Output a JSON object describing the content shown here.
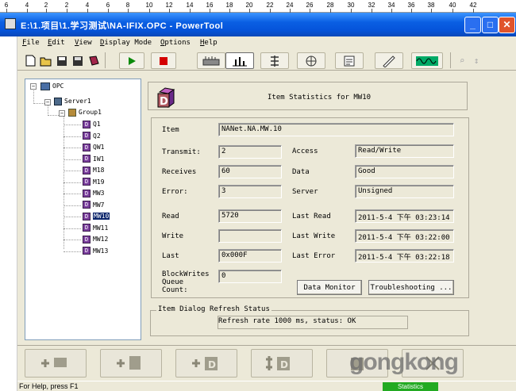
{
  "ruler": {
    "ticks": [
      "6",
      "4",
      "2",
      "2",
      "4",
      "6",
      "8",
      "10",
      "12",
      "14",
      "16",
      "18",
      "20",
      "22",
      "24",
      "26",
      "28",
      "30",
      "32",
      "34",
      "36",
      "38",
      "40",
      "42"
    ]
  },
  "window": {
    "title": "E:\\1.项目\\1.学习测试\\NA-IFIX.OPC - PowerTool",
    "min": "_",
    "max": "□",
    "close": "✕"
  },
  "menu": [
    "File",
    "Edit",
    "View",
    "Display Mode",
    "Options",
    "Help"
  ],
  "tree": {
    "root": "OPC",
    "server": "Server1",
    "group": "Group1",
    "items": [
      "Q1",
      "Q2",
      "QW1",
      "IW1",
      "M18",
      "M19",
      "MW3",
      "MW7",
      "MW10",
      "MW11",
      "MW12",
      "MW13"
    ],
    "selected": "MW10"
  },
  "header": {
    "title": "Item Statistics for MW10"
  },
  "form": {
    "item_label": "Item",
    "item_value": "NANet.NA.MW.10",
    "transmit_label": "Transmit:",
    "transmit_value": "2",
    "access_label": "Access",
    "access_value": "Read/Write",
    "receives_label": "Receives",
    "receives_value": "60",
    "data_label": "Data",
    "data_value": "Good",
    "error_label": "Error:",
    "error_value": "3",
    "server_label": "Server",
    "server_value": "Unsigned",
    "read_label": "Read",
    "read_value": "5720",
    "last_read_label": "Last Read",
    "last_read_value": "2011-5-4 下午 03:23:14",
    "write_label": "Write",
    "write_value": "",
    "last_write_label": "Last Write",
    "last_write_value": "2011-5-4 下午 03:22:00",
    "last_label": "Last",
    "last_value": "0x000F",
    "last_error_label": "Last Error",
    "last_error_value": "2011-5-4 下午 03:22:18",
    "blockwrites_label_1": "BlockWrites",
    "blockwrites_label_2": "Queue",
    "blockwrites_label_3": "Count:",
    "blockwrites_value": "0",
    "data_monitor_button": "Data Monitor",
    "troubleshooting_button": "Troubleshooting ..."
  },
  "refresh": {
    "label": "Item Dialog Refresh Status",
    "status": "Refresh rate 1000 ms, status: OK"
  },
  "status": {
    "help": "For Help, press F1",
    "mode": "Statistics"
  },
  "watermark": "gongkong",
  "colors": {
    "title_bar": "#0a5fe3",
    "selection": "#0a246a",
    "status_ok": "#22aa22",
    "tag_icon": "#7a3e9d"
  }
}
